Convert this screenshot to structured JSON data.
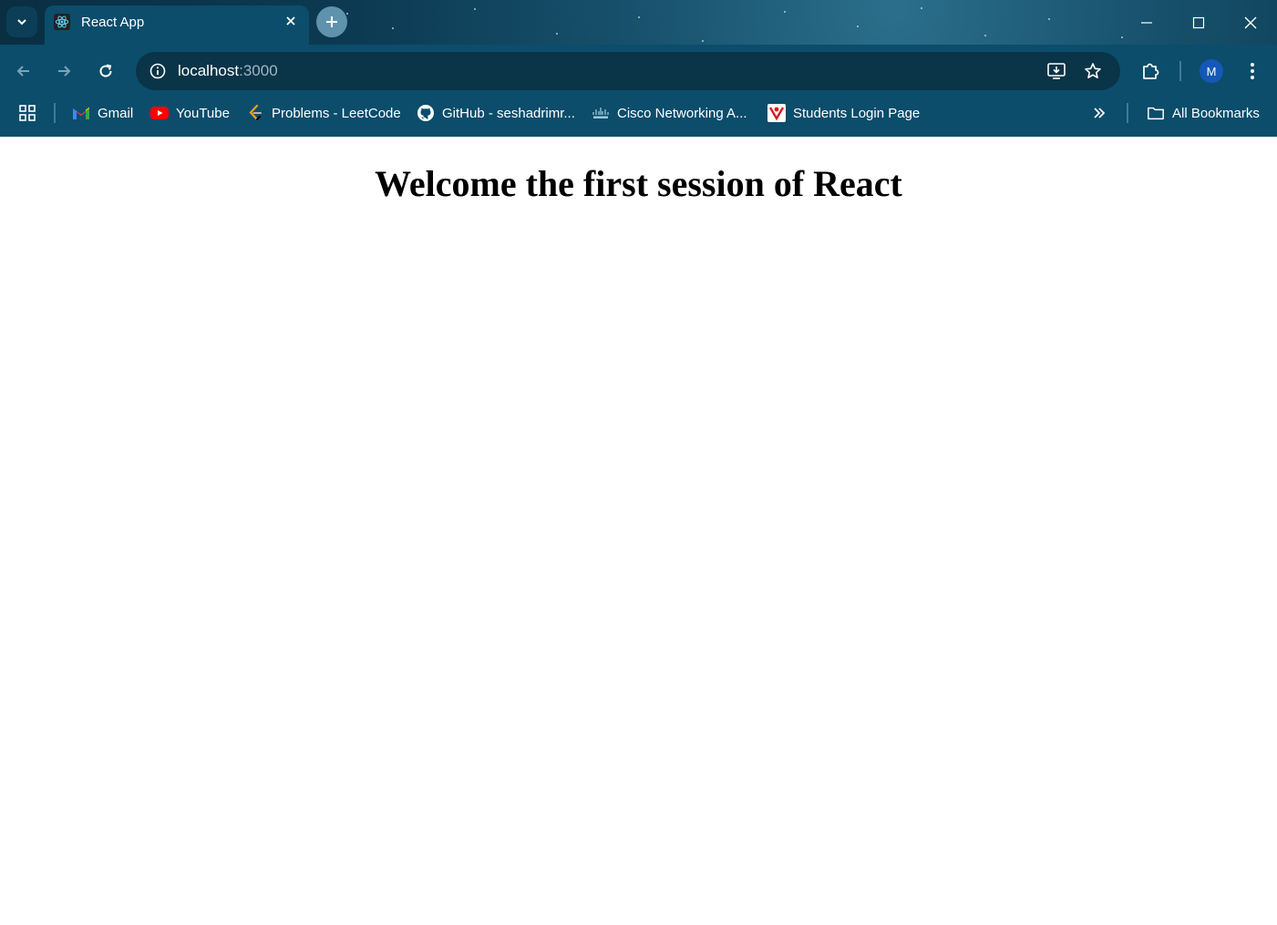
{
  "browser": {
    "tab": {
      "title": "React App",
      "favicon": "react-icon"
    },
    "address": {
      "host": "localhost",
      "port": ":3000"
    },
    "avatar_initial": "M",
    "colors": {
      "frame": "#0b4d6b",
      "omnibox": "#0a3448",
      "avatar": "#1558b8"
    }
  },
  "bookmarks": {
    "items": [
      {
        "label": "Gmail",
        "icon": "gmail-icon"
      },
      {
        "label": "YouTube",
        "icon": "youtube-icon"
      },
      {
        "label": "Problems - LeetCode",
        "icon": "leetcode-icon"
      },
      {
        "label": "GitHub - seshadrimr...",
        "icon": "github-icon"
      },
      {
        "label": "Cisco Networking A...",
        "icon": "cisco-icon"
      },
      {
        "label": "Students Login Page",
        "icon": "students-icon"
      }
    ],
    "all_label": "All Bookmarks"
  },
  "page": {
    "heading": "Welcome the first session of React"
  }
}
